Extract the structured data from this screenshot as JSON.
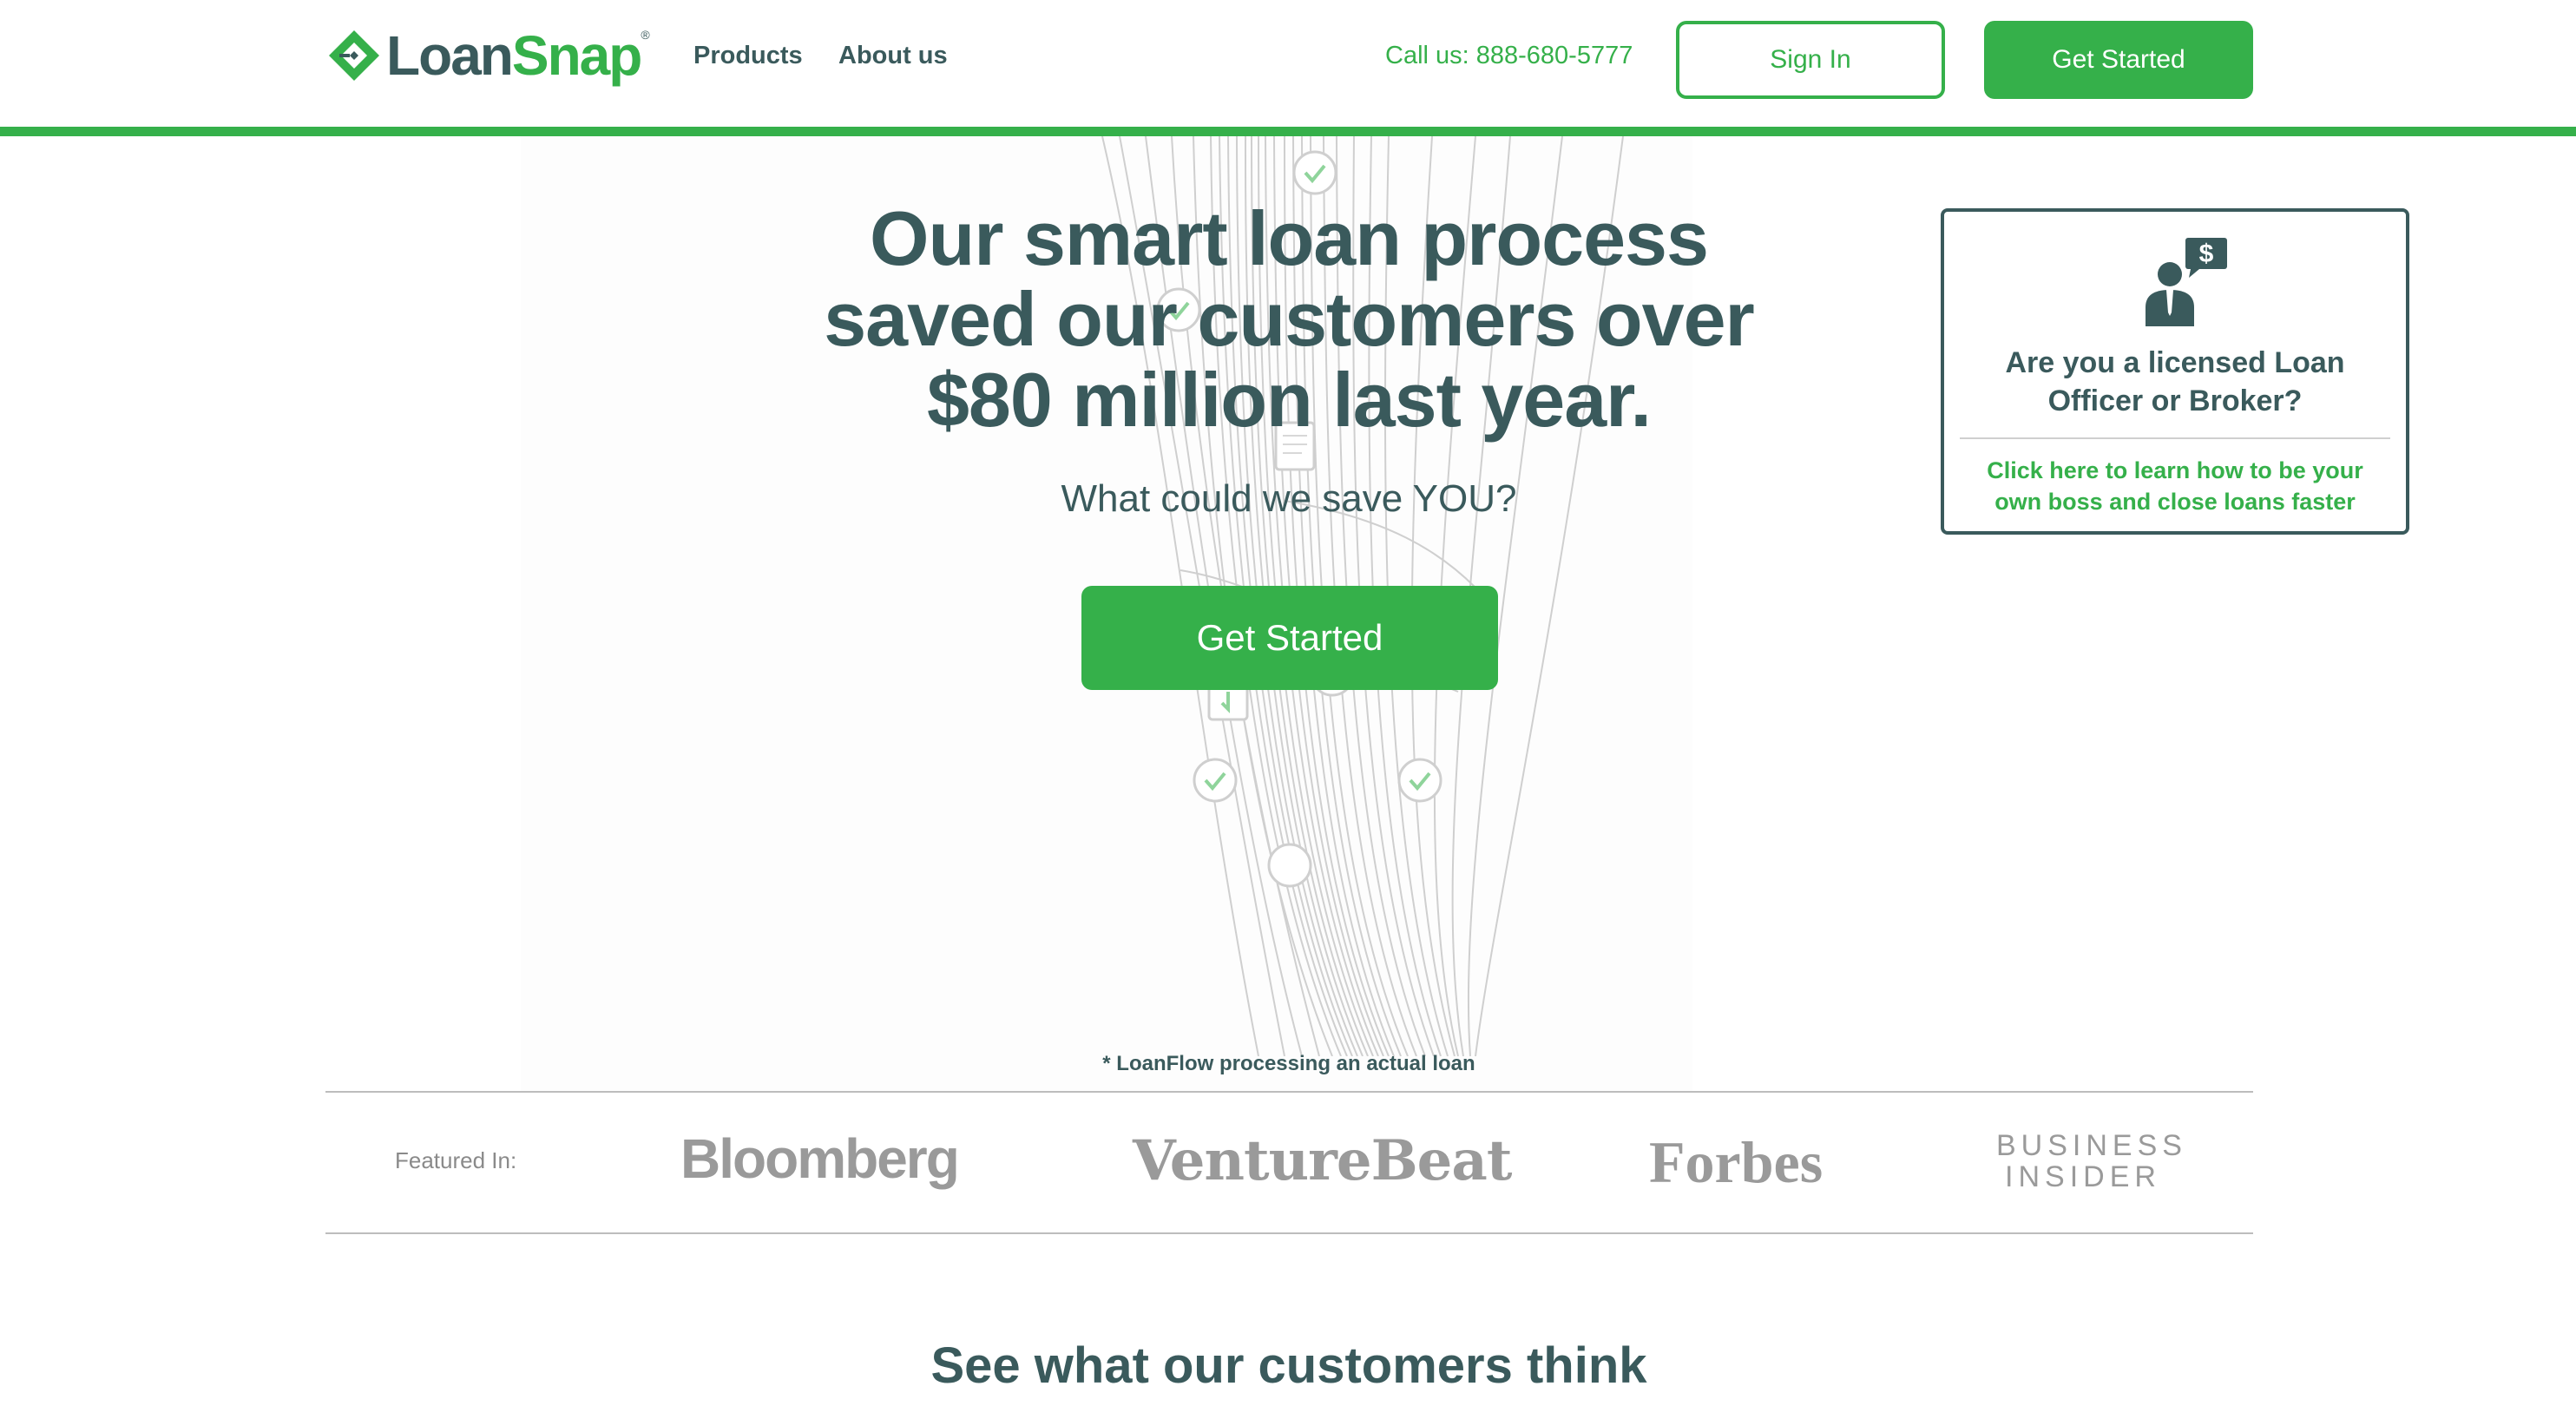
{
  "header": {
    "logo": {
      "part1": "Loan",
      "part2": "Snap",
      "reg": "®"
    },
    "nav": [
      {
        "label": "Products"
      },
      {
        "label": "About us"
      }
    ],
    "call_us": "Call us: 888-680-5777",
    "sign_in_label": "Sign In",
    "get_started_label": "Get Started",
    "accent_color": "#35b04a",
    "text_color": "#3a5a5c"
  },
  "hero": {
    "title_line1": "Our smart loan process",
    "title_line2": "saved our customers over",
    "title_line3": "$80 million last year.",
    "subtitle": "What could we save YOU?",
    "cta_label": "Get Started",
    "caption": "* LoanFlow processing an actual loan"
  },
  "loan_officer_card": {
    "icon": "loan-officer-icon",
    "icon_badge": "$",
    "title": "Are you a licensed Loan Officer or Broker?",
    "link": "Click here to learn how to be your own boss and close loans faster"
  },
  "featured": {
    "label": "Featured In:",
    "outlets": [
      {
        "name": "Bloomberg"
      },
      {
        "name": "VentureBeat"
      },
      {
        "name": "Forbes"
      },
      {
        "name_line1": "BUSINESS",
        "name_line2": "INSIDER"
      }
    ]
  },
  "testimonials": {
    "heading": "See what our customers think"
  }
}
